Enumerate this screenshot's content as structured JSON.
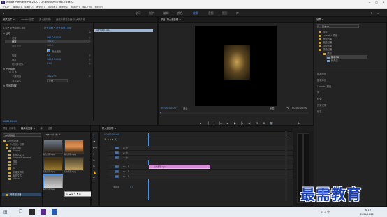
{
  "window": {
    "title": "Adobe Premiere Pro 2020 - D:\\视频\\000\\未命名 [未命名]",
    "minimize": "─",
    "maximize": "□",
    "close": "✕"
  },
  "menu": [
    "文件(F)",
    "编辑(E)",
    "剪辑(C)",
    "序列(S)",
    "标记(M)",
    "图形(G)",
    "视图(V)",
    "窗口(W)",
    "帮助(H)"
  ],
  "workspaces": [
    {
      "label": "学习"
    },
    {
      "label": "组件"
    },
    {
      "label": "编辑"
    },
    {
      "label": "颜色"
    },
    {
      "label": "效果",
      "active": true
    },
    {
      "label": "音频"
    },
    {
      "label": "图形"
    },
    {
      "label": "库"
    }
  ],
  "effect_controls": {
    "tabs": [
      "效果控件 ≡",
      "Lumetri 范围",
      "源:(无剪辑)",
      "音频剪辑混合器: 好大的剪辑"
    ],
    "source_label": "主要 • 好大剪辑1.jpg",
    "clip_label": "好大剪辑 • 好大剪辑1.jpg",
    "header_clip": "好大剪辑1.jpg",
    "motion": "fx 运动",
    "rows": [
      {
        "label": "位置",
        "value": "960.0   540.0"
      },
      {
        "label": "缩放",
        "value": "100.0"
      },
      {
        "label": "缩放宽度",
        "value": "100.0"
      },
      {
        "label": "",
        "value": "等比缩放"
      },
      {
        "label": "旋转",
        "value": "0.0"
      },
      {
        "label": "锚点",
        "value": "960.0   540.0"
      },
      {
        "label": "防闪烁滤镜",
        "value": "0.00"
      },
      {
        "label": "fx 不透明度",
        "value": ""
      },
      {
        "label": "不透明度",
        "value": "100.0 %"
      },
      {
        "label": "混合模式",
        "value": "正常"
      },
      {
        "label": "fx 时间重映射",
        "value": ""
      }
    ],
    "timecode": "00:00:00:00"
  },
  "program_monitor": {
    "title": "节目: 好大的剪辑 ≡",
    "timecode_left": "00:00:00:00",
    "fit": "适合",
    "full": "完整",
    "timecode_right": "00:00:05:00"
  },
  "transport": [
    "▾",
    "{",
    "}",
    "|←",
    "◂|",
    "▶",
    "|▸",
    "→|",
    "⊟",
    "⊞",
    "📷",
    "+"
  ],
  "project": {
    "tabs": [
      "项目: 未命名",
      "媒体浏览器 ≡",
      "库",
      "信息"
    ],
    "path": "本地驱动器",
    "tree": [
      "本地驱动器",
      "C:(系统) 目录",
      "D:(新加卷)",
      "Adobe",
      "未命名文件",
      "Adobe Premiere",
      "视频",
      "000",
      "00",
      "新建文件夹",
      "素材文件",
      "Videos",
      "网络驱动器"
    ],
    "thumbs": [
      {
        "name": "好大剪辑1.jpg",
        "dur": "5:00"
      },
      {
        "name": "好大剪辑2.jpg",
        "dur": "5:00"
      },
      {
        "name": "好大剪辑3.jpg",
        "dur": "5:00"
      },
      {
        "name": "好大剪辑4.jpg",
        "dur": "5:00"
      },
      {
        "name": "好大剪辑5.jpg",
        "dur": "5:00"
      }
    ]
  },
  "timeline": {
    "tab": "好大的剪辑 ≡",
    "timecode": "00:00:00:00",
    "tracks": [
      "V3",
      "V2",
      "V1",
      "A1",
      "A2",
      "A3",
      "主声道"
    ],
    "clip_name": "好大剪辑1.jpg",
    "master_value": "0.0"
  },
  "effects_panel": {
    "title": "效果 ≡",
    "search": "基本3D",
    "items": [
      "预设",
      "Lumetri 预设",
      "音频效果",
      "音频过渡",
      "视频效果",
      "视频过渡",
      "透视",
      "基本3D",
      "斜角边"
    ],
    "sections": [
      "基本图形",
      "基本声音",
      "Lumetri 颜色",
      "库",
      "标记",
      "历史记录",
      "信息"
    ]
  },
  "watermark": "最需教育",
  "taskbar": {
    "time": "6:19",
    "date": "2021/10/22"
  }
}
